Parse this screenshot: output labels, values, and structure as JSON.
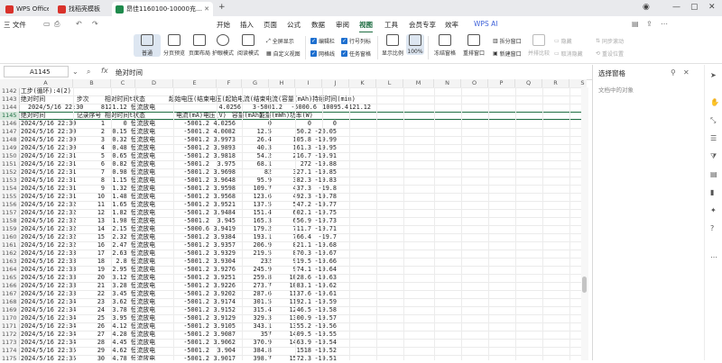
{
  "tabs": [
    {
      "label": "WPS Office",
      "color": "#d9322b",
      "icon": "wps-logo-icon"
    },
    {
      "label": "找稻壳模板",
      "color": "#d9322b",
      "icon": "docer-icon"
    },
    {
      "label": "昂佳1160100-10000充放电...",
      "color": "#1f8a4c",
      "icon": "spreadsheet-icon",
      "active": true
    }
  ],
  "menu": {
    "file": "三 文件",
    "items": [
      "开始",
      "插入",
      "页面",
      "公式",
      "数据",
      "审阅",
      "视图",
      "工具",
      "会员专享",
      "效率"
    ],
    "active": "视图",
    "wps_ai": "WPS AI"
  },
  "ribbon": {
    "views": [
      "普通",
      "分页预览",
      "页面布局",
      "护眼模式",
      "阅读模式",
      "自定义视图"
    ],
    "fullscreen": "全屏显示",
    "editbar": "编辑栏",
    "gridlines": "网格线",
    "headings": "行号列标",
    "taskpane": "任务窗格",
    "display_ratio": "显示比例",
    "zoom": "100%",
    "freeze": "冻结窗格",
    "rearrange": "重排窗口",
    "split": "拆分窗口",
    "newwin": "新建窗口",
    "side_by_side": "并排比较",
    "hide": "隐藏",
    "unhide": "取消隐藏",
    "sync_scroll": "同步滚动",
    "reset_pos": "重设位置"
  },
  "formula_bar": {
    "name_box": "A1145",
    "content": "绝对时间"
  },
  "columns": [
    "A",
    "B",
    "C",
    "D",
    "E",
    "F",
    "G",
    "H",
    "I",
    "J",
    "K",
    "L",
    "M",
    "N",
    "O",
    "P",
    "Q",
    "R",
    "S"
  ],
  "rows": [
    {
      "n": "1142",
      "text": [
        "工步(循环):4(2)"
      ]
    },
    {
      "n": "1143",
      "text": [
        "绝对时间",
        "步次",
        "相对时间t状态",
        "起始电压(结束电压(起始电流(结束电流(容量(mAh)持续时间(min)"
      ]
    },
    {
      "n": "1144",
      "cells": [
        "2024/5/16 22:30",
        "8",
        "121.12 恒流放电",
        "",
        "4.0256",
        "3",
        "-5001.2",
        "-5000.6",
        "10095.4",
        "121.12"
      ]
    },
    {
      "n": "1145",
      "selected": true,
      "text": [
        "绝对时间",
        "记录序号",
        "相对时间t状态",
        "电流(mA)",
        "电压(V)",
        "容量(mAh)",
        "能量(mWh)",
        "功率(W)"
      ]
    },
    {
      "n": "1146",
      "cells": [
        "2024/5/16 22:30",
        "1",
        "0 恒流放电",
        "-5001.2",
        "4.0256",
        "0",
        "0",
        "0"
      ]
    },
    {
      "n": "1147",
      "cells": [
        "2024/5/16 22:30",
        "2",
        "0.15 恒流放电",
        "-5001.2",
        "4.0082",
        "12.5",
        "50.2",
        "-20.05"
      ]
    },
    {
      "n": "1148",
      "cells": [
        "2024/5/16 22:30",
        "3",
        "0.32 恒流放电",
        "-5001.2",
        "3.9973",
        "26.4",
        "105.8",
        "-19.99"
      ]
    },
    {
      "n": "1149",
      "cells": [
        "2024/5/16 22:30",
        "4",
        "0.48 恒流放电",
        "-5001.2",
        "3.9893",
        "40.3",
        "161.3",
        "-19.95"
      ]
    },
    {
      "n": "1150",
      "cells": [
        "2024/5/16 22:31",
        "5",
        "0.65 恒流放电",
        "-5001.2",
        "3.9818",
        "54.2",
        "216.7",
        "-19.91"
      ]
    },
    {
      "n": "1151",
      "cells": [
        "2024/5/16 22:31",
        "6",
        "0.82 恒流放电",
        "-5001.2",
        "3.975",
        "68.1",
        "272",
        "-19.88"
      ]
    },
    {
      "n": "1152",
      "cells": [
        "2024/5/16 22:31",
        "7",
        "0.98 恒流放电",
        "-5001.2",
        "3.9698",
        "82",
        "327.1",
        "-19.85"
      ]
    },
    {
      "n": "1153",
      "cells": [
        "2024/5/16 22:31",
        "8",
        "1.15 恒流放电",
        "-5001.2",
        "3.9648",
        "95.9",
        "382.3",
        "-19.83"
      ]
    },
    {
      "n": "1154",
      "cells": [
        "2024/5/16 22:31",
        "9",
        "1.32 恒流放电",
        "-5001.2",
        "3.9598",
        "109.7",
        "437.3",
        "-19.8"
      ]
    },
    {
      "n": "1155",
      "cells": [
        "2024/5/16 22:31",
        "10",
        "1.48 恒流放电",
        "-5001.2",
        "3.9568",
        "123.6",
        "492.3",
        "-19.78"
      ]
    },
    {
      "n": "1156",
      "cells": [
        "2024/5/16 22:32",
        "11",
        "1.65 恒流放电",
        "-5001.2",
        "3.9521",
        "137.5",
        "547.2",
        "-19.77"
      ]
    },
    {
      "n": "1157",
      "cells": [
        "2024/5/16 22:32",
        "12",
        "1.82 恒流放电",
        "-5001.2",
        "3.9484",
        "151.4",
        "602.1",
        "-19.75"
      ]
    },
    {
      "n": "1158",
      "cells": [
        "2024/5/16 22:32",
        "13",
        "1.98 恒流放电",
        "-5001.2",
        "3.945",
        "165.3",
        "656.9",
        "-19.73"
      ]
    },
    {
      "n": "1159",
      "cells": [
        "2024/5/16 22:32",
        "14",
        "2.15 恒流放电",
        "-5000.6",
        "3.9419",
        "179.2",
        "711.7",
        "-19.71"
      ]
    },
    {
      "n": "1160",
      "cells": [
        "2024/5/16 22:32",
        "15",
        "2.32 恒流放电",
        "-5001.2",
        "3.9384",
        "193.1",
        "766.4",
        "-19.7"
      ]
    },
    {
      "n": "1161",
      "cells": [
        "2024/5/16 22:32",
        "16",
        "2.47 恒流放电",
        "-5001.2",
        "3.9357",
        "206.9",
        "821.1",
        "-19.68"
      ]
    },
    {
      "n": "1162",
      "cells": [
        "2024/5/16 22:33",
        "17",
        "2.63 恒流放电",
        "-5001.2",
        "3.9329",
        "219.5",
        "870.3",
        "-19.67"
      ]
    },
    {
      "n": "1163",
      "cells": [
        "2024/5/16 22:33",
        "18",
        "2.8 恒流放电",
        "-5001.2",
        "3.9304",
        "232",
        "919.5",
        "-19.66"
      ]
    },
    {
      "n": "1164",
      "cells": [
        "2024/5/16 22:33",
        "19",
        "2.95 恒流放电",
        "-5001.2",
        "3.9276",
        "245.9",
        "974.1",
        "-19.64"
      ]
    },
    {
      "n": "1165",
      "cells": [
        "2024/5/16 22:33",
        "20",
        "3.12 恒流放电",
        "-5001.2",
        "3.9251",
        "259.8",
        "1028.6",
        "-19.63"
      ]
    },
    {
      "n": "1166",
      "cells": [
        "2024/5/16 22:33",
        "21",
        "3.28 恒流放电",
        "-5001.2",
        "3.9226",
        "273.7",
        "1083.1",
        "-19.62"
      ]
    },
    {
      "n": "1167",
      "cells": [
        "2024/5/16 22:33",
        "22",
        "3.45 恒流放电",
        "-5001.2",
        "3.9202",
        "287.6",
        "1137.6",
        "-19.61"
      ]
    },
    {
      "n": "1168",
      "cells": [
        "2024/5/16 22:34",
        "23",
        "3.62 恒流放电",
        "-5001.2",
        "3.9174",
        "301.5",
        "1192.1",
        "-19.59"
      ]
    },
    {
      "n": "1169",
      "cells": [
        "2024/5/16 22:34",
        "24",
        "3.78 恒流放电",
        "-5001.2",
        "3.9152",
        "315.4",
        "1246.5",
        "-19.58"
      ]
    },
    {
      "n": "1170",
      "cells": [
        "2024/5/16 22:34",
        "25",
        "3.95 恒流放电",
        "-5001.2",
        "3.9129",
        "329.3",
        "1300.9",
        "-19.57"
      ]
    },
    {
      "n": "1171",
      "cells": [
        "2024/5/16 22:34",
        "26",
        "4.12 恒流放电",
        "-5001.2",
        "3.9105",
        "343.1",
        "1355.2",
        "-19.56"
      ]
    },
    {
      "n": "1172",
      "cells": [
        "2024/5/16 22:34",
        "27",
        "4.28 恒流放电",
        "-5001.2",
        "3.9087",
        "357",
        "1409.5",
        "-19.55"
      ]
    },
    {
      "n": "1173",
      "cells": [
        "2024/5/16 22:34",
        "28",
        "4.45 恒流放电",
        "-5001.2",
        "3.9062",
        "370.9",
        "1463.9",
        "-19.54"
      ]
    },
    {
      "n": "1174",
      "cells": [
        "2024/5/16 22:35",
        "29",
        "4.62 恒流放电",
        "-5001.2",
        "3.904",
        "384.8",
        "1518",
        "-19.52"
      ]
    },
    {
      "n": "1175",
      "cells": [
        "2024/5/16 22:35",
        "30",
        "4.78 恒流放电",
        "-5001.2",
        "3.9017",
        "398.7",
        "1572.3",
        "-19.51"
      ]
    }
  ],
  "task_pane": {
    "title": "选择窗格",
    "subtitle": "文档中的对象"
  }
}
